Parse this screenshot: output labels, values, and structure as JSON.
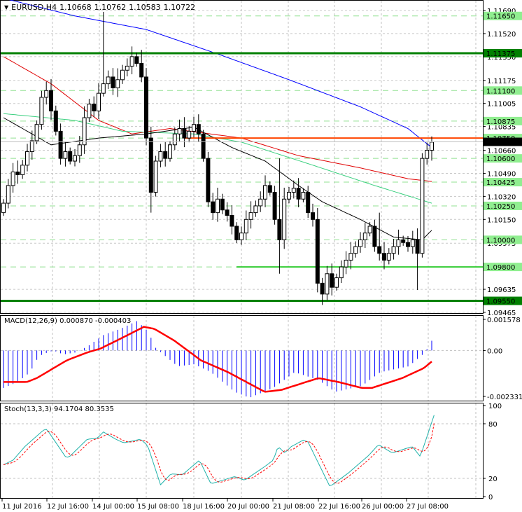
{
  "header": {
    "symbol": "EURUSD,H4",
    "open": "1.10668",
    "high": "1.10762",
    "low": "1.10583",
    "close": "1.10722"
  },
  "chart_data": [
    {
      "type": "candlestick",
      "title": "EURUSD,H4",
      "ylim": [
        1.09465,
        1.1169
      ],
      "price_ticks": [
        "1.11690",
        "1.11520",
        "1.11350",
        "1.11175",
        "1.11005",
        "1.10835",
        "1.10660",
        "1.10490",
        "1.10320",
        "1.10150",
        "1.09975",
        "1.09635",
        "1.09465"
      ],
      "level_labels": [
        {
          "value": "1.11650",
          "kind": "light"
        },
        {
          "value": "1.11375",
          "kind": "dark"
        },
        {
          "value": "1.11100",
          "kind": "light"
        },
        {
          "value": "1.10875",
          "kind": "light"
        },
        {
          "value": "1.10750",
          "kind": "light"
        },
        {
          "value": "1.10600",
          "kind": "light"
        },
        {
          "value": "1.10425",
          "kind": "light"
        },
        {
          "value": "1.10250",
          "kind": "light"
        },
        {
          "value": "1.10000",
          "kind": "light"
        },
        {
          "value": "1.09800",
          "kind": "light"
        },
        {
          "value": "1.09550",
          "kind": "dark"
        }
      ],
      "current_price": "1.10722",
      "closes": [
        1.1027,
        1.104,
        1.105,
        1.1048,
        1.1055,
        1.1065,
        1.1073,
        1.1085,
        1.1105,
        1.111,
        1.1095,
        1.108,
        1.106,
        1.1065,
        1.1058,
        1.1062,
        1.107,
        1.109,
        1.11,
        1.1095,
        1.1108,
        1.1115,
        1.112,
        1.1112,
        1.1118,
        1.1125,
        1.1128,
        1.1135,
        1.113,
        1.112,
        1.1075,
        1.1035,
        1.1058,
        1.1065,
        1.106,
        1.107,
        1.1078,
        1.1082,
        1.1075,
        1.108,
        1.1085,
        1.1078,
        1.106,
        1.1028,
        1.102,
        1.103,
        1.1022,
        1.1018,
        1.101,
        1.1,
        1.1005,
        1.1015,
        1.102,
        1.1025,
        1.103,
        1.104,
        1.1035,
        1.1015,
        1.1,
        1.103,
        1.1035,
        1.1038,
        1.103,
        1.1035,
        1.102,
        1.1015,
        1.0968,
        1.096,
        1.0975,
        1.0965,
        1.0972,
        1.098,
        1.0985,
        1.099,
        1.0995,
        1.1,
        1.1005,
        1.101,
        1.0995,
        1.099,
        1.0985,
        1.099,
        1.0995,
        1.1,
        1.0998,
        1.0995,
        1.1,
        1.099,
        1.106,
        1.1066,
        1.1072
      ],
      "first_open": 1.102,
      "wick_overrides": {
        "21": [
          1.1168,
          null
        ],
        "29": [
          1.114,
          null
        ],
        "31": [
          null,
          1.102
        ],
        "58": [
          1.106,
          1.0975
        ],
        "67": [
          null,
          1.0952
        ],
        "79": [
          1.102,
          null
        ],
        "87": [
          null,
          1.0963
        ],
        "90": [
          1.10762,
          1.10583
        ]
      },
      "moving_averages": [
        {
          "name": "MA blue",
          "color": "#0000ff",
          "points": [
            [
              0,
              1.1178
            ],
            [
              15,
              1.1165
            ],
            [
              30,
              1.1155
            ],
            [
              45,
              1.1137
            ],
            [
              60,
              1.1118
            ],
            [
              75,
              1.1098
            ],
            [
              85,
              1.1082
            ],
            [
              90,
              1.1068
            ]
          ]
        },
        {
          "name": "MA red",
          "color": "#e00000",
          "points": [
            [
              0,
              1.1135
            ],
            [
              10,
              1.1115
            ],
            [
              20,
              1.1088
            ],
            [
              27,
              1.1078
            ],
            [
              35,
              1.1082
            ],
            [
              50,
              1.1075
            ],
            [
              62,
              1.1062
            ],
            [
              75,
              1.1053
            ],
            [
              85,
              1.1045
            ],
            [
              90,
              1.1043
            ]
          ]
        },
        {
          "name": "MA green",
          "color": "#3cd080",
          "points": [
            [
              0,
              1.1093
            ],
            [
              15,
              1.1088
            ],
            [
              25,
              1.108
            ],
            [
              40,
              1.1078
            ],
            [
              50,
              1.1072
            ],
            [
              65,
              1.1055
            ],
            [
              78,
              1.104
            ],
            [
              90,
              1.1027
            ]
          ]
        },
        {
          "name": "MA black",
          "color": "#000000",
          "points": [
            [
              0,
              1.109
            ],
            [
              5,
              1.108
            ],
            [
              10,
              1.107
            ],
            [
              20,
              1.1075
            ],
            [
              30,
              1.1078
            ],
            [
              40,
              1.1083
            ],
            [
              48,
              1.1068
            ],
            [
              55,
              1.1058
            ],
            [
              62,
              1.104
            ],
            [
              67,
              1.1028
            ],
            [
              75,
              1.1015
            ],
            [
              82,
              1.1002
            ],
            [
              88,
              1.1
            ],
            [
              90,
              1.1007
            ]
          ]
        }
      ],
      "horizontal_lines": [
        {
          "value": 1.11375,
          "color": "#008000",
          "from_index": -1
        },
        {
          "value": 1.0955,
          "color": "#008000",
          "from_index": -1
        },
        {
          "value": 1.098,
          "color": "#33cc33",
          "from_index": 49
        },
        {
          "value": 1.1075,
          "color": "#ff4500",
          "from_index": 38
        }
      ],
      "x_labels": [
        "11 Jul 2016",
        "12 Jul 16:00",
        "14 Jul 00:00",
        "15 Jul 08:00",
        "18 Jul 16:00",
        "20 Jul 00:00",
        "21 Jul 08:00",
        "22 Jul 16:00",
        "26 Jul 00:00",
        "27 Jul 08:00"
      ]
    },
    {
      "type": "macd",
      "label": "MACD(12,26,9) 0.000870 -0.000403",
      "ylim": [
        -0.002331,
        0.001578
      ],
      "ticks": [
        "0.001578",
        "0.00",
        "-0.002331"
      ],
      "histogram": [
        [
          0,
          -0.0019
        ],
        [
          2,
          -0.0017
        ],
        [
          3.5,
          -0.0015
        ],
        [
          5.6,
          -0.0011
        ],
        [
          6.9,
          -0.0005
        ],
        [
          8.1,
          -0.0002
        ],
        [
          10.5,
          0
        ],
        [
          12.6,
          -0.0002
        ],
        [
          15.1,
          -0.0001
        ],
        [
          17.6,
          0.0002
        ],
        [
          21.1,
          0.0008
        ],
        [
          24.6,
          0.0011
        ],
        [
          28.1,
          0.0015
        ],
        [
          30.6,
          0.0009
        ],
        [
          31.7,
          0.0002
        ],
        [
          33.1,
          -0.0001
        ],
        [
          36.6,
          -0.0008
        ],
        [
          40.1,
          -0.0007
        ],
        [
          43.6,
          -0.0011
        ],
        [
          48.6,
          -0.0021
        ],
        [
          51.7,
          -0.0024
        ],
        [
          56.7,
          -0.0019
        ],
        [
          61.2,
          -0.0011
        ],
        [
          66.2,
          -0.0015
        ],
        [
          69.7,
          -0.0021
        ],
        [
          75.3,
          -0.0018
        ],
        [
          79.2,
          -0.0011
        ],
        [
          85.2,
          -0.0008
        ],
        [
          88.6,
          -0.0001
        ],
        [
          89.8,
          0.0004
        ],
        [
          90.8,
          0.00087
        ]
      ],
      "signal": [
        [
          0,
          -0.0016
        ],
        [
          4.9,
          -0.0016
        ],
        [
          7,
          -0.0014
        ],
        [
          13.3,
          -0.0005
        ],
        [
          17.6,
          -0.0001
        ],
        [
          20.4,
          0.0001
        ],
        [
          24.6,
          0.0006
        ],
        [
          29.5,
          0.0012
        ],
        [
          31.7,
          0.0011
        ],
        [
          35.9,
          0.0005
        ],
        [
          41.5,
          -0.0005
        ],
        [
          47.2,
          -0.0011
        ],
        [
          54.9,
          -0.0021
        ],
        [
          58.4,
          -0.002
        ],
        [
          66.2,
          -0.0014
        ],
        [
          70.4,
          -0.0016
        ],
        [
          75.3,
          -0.0019
        ],
        [
          77.4,
          -0.0019
        ],
        [
          83.8,
          -0.0014
        ],
        [
          88.3,
          -0.0009
        ],
        [
          90.8,
          -0.000403
        ]
      ],
      "hist_color": "#0000ff",
      "signal_color": "#ff0000"
    },
    {
      "type": "stochastic",
      "label": "Stoch(13,3,3) 94.1704 80.3535",
      "ylim": [
        0,
        100
      ],
      "ticks": [
        "100",
        "80",
        "20",
        "0"
      ],
      "main": [
        [
          0,
          35
        ],
        [
          2,
          40
        ],
        [
          4,
          52
        ],
        [
          4.5,
          55
        ],
        [
          8.4,
          73
        ],
        [
          9.1,
          74
        ],
        [
          13,
          44
        ],
        [
          13.7,
          43
        ],
        [
          17.6,
          63
        ],
        [
          19.7,
          64
        ],
        [
          21,
          71
        ],
        [
          23.6,
          63
        ],
        [
          25.3,
          59
        ],
        [
          28.8,
          63
        ],
        [
          30.3,
          56
        ],
        [
          33,
          13
        ],
        [
          35.2,
          25
        ],
        [
          37.6,
          24
        ],
        [
          41.2,
          40
        ],
        [
          43.6,
          14
        ],
        [
          48.6,
          22
        ],
        [
          50.7,
          18
        ],
        [
          54.9,
          33
        ],
        [
          56.7,
          40
        ],
        [
          57.7,
          55
        ],
        [
          59.1,
          48
        ],
        [
          60.5,
          55
        ],
        [
          63,
          62
        ],
        [
          64,
          60
        ],
        [
          68.6,
          11
        ],
        [
          72.5,
          26
        ],
        [
          76.7,
          45
        ],
        [
          78.8,
          57
        ],
        [
          81.7,
          48
        ],
        [
          85.9,
          55
        ],
        [
          87.6,
          44
        ],
        [
          90.8,
          94.17
        ]
      ],
      "signal_last": 80.35,
      "main_color": "#20b2aa",
      "signal_color": "#ff0000"
    }
  ]
}
